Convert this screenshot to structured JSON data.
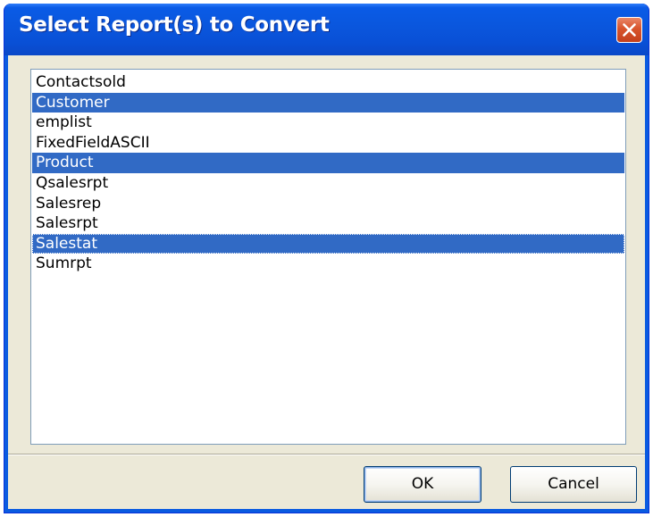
{
  "dialog": {
    "title": "Select Report(s) to Convert"
  },
  "reports": {
    "items": [
      {
        "label": "Contactsold",
        "selected": false
      },
      {
        "label": "Customer",
        "selected": true
      },
      {
        "label": "emplist",
        "selected": false
      },
      {
        "label": "FixedFieldASCII",
        "selected": false
      },
      {
        "label": "Product",
        "selected": true
      },
      {
        "label": "Qsalesrpt",
        "selected": false
      },
      {
        "label": "Salesrep",
        "selected": false
      },
      {
        "label": "Salesrpt",
        "selected": false
      },
      {
        "label": "Salestat",
        "selected": true
      },
      {
        "label": "Sumrpt",
        "selected": false
      }
    ]
  },
  "buttons": {
    "ok_label": "OK",
    "cancel_label": "Cancel"
  },
  "colors": {
    "title_bar": "#0a5be0",
    "selection": "#316ac5",
    "close_button": "#d8542c",
    "dialog_background": "#ece9d8"
  },
  "icons": {
    "close": "close-icon"
  }
}
